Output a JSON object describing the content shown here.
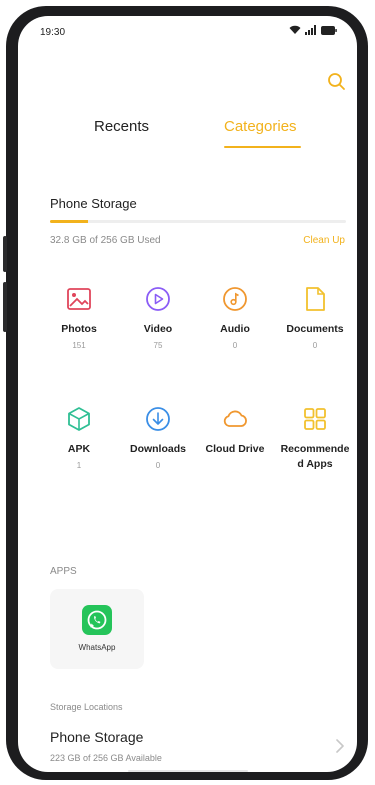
{
  "status_bar": {
    "time": "19:30"
  },
  "tabs": [
    {
      "label": "Recents",
      "active": false
    },
    {
      "label": "Categories",
      "active": true
    }
  ],
  "storage": {
    "title": "Phone Storage",
    "used_text": "32.8 GB of 256 GB Used",
    "used_fraction": 0.128,
    "clean_up": "Clean Up"
  },
  "categories": [
    {
      "label": "Photos",
      "count": "151",
      "icon": "photos-icon",
      "color": "#e0455b"
    },
    {
      "label": "Video",
      "count": "75",
      "icon": "video-icon",
      "color": "#8a5cf6"
    },
    {
      "label": "Audio",
      "count": "0",
      "icon": "audio-icon",
      "color": "#f0972f"
    },
    {
      "label": "Documents",
      "count": "0",
      "icon": "document-icon",
      "color": "#f2c12e"
    },
    {
      "label": "APK",
      "count": "1",
      "icon": "apk-icon",
      "color": "#2fbf94"
    },
    {
      "label": "Downloads",
      "count": "0",
      "icon": "download-icon",
      "color": "#3a8ee6"
    },
    {
      "label": "Cloud Drive",
      "count": "",
      "icon": "cloud-icon",
      "color": "#f0972f"
    },
    {
      "label": "Recommended Apps",
      "count": "",
      "icon": "grid-icon",
      "color": "#f2c12e"
    }
  ],
  "apps": {
    "title": "APPS",
    "items": [
      {
        "name": "WhatsApp",
        "icon": "whatsapp-icon",
        "color": "#25c45a"
      }
    ]
  },
  "storage_locations": {
    "title": "Storage Locations",
    "items": [
      {
        "name": "Phone Storage",
        "available": "223 GB of 256 GB Available"
      }
    ]
  },
  "colors": {
    "accent": "#f2b21c"
  }
}
